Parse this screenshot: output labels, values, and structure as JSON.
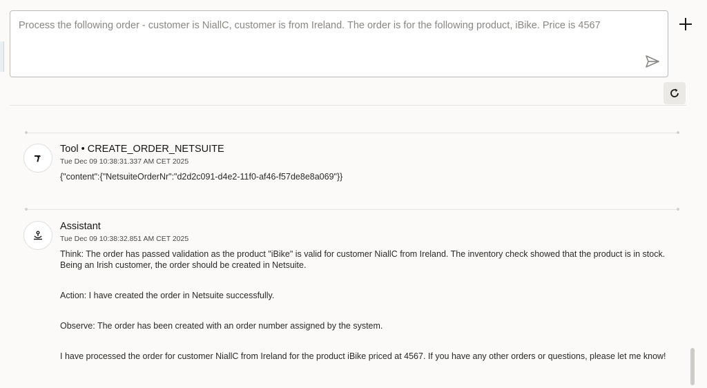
{
  "prompt": {
    "text": "Process the following order - customer is NiallC, customer is from Ireland. The order is for the following product, iBike.  Price is 4567"
  },
  "icons": {
    "add": "plus-icon",
    "send": "send-icon",
    "refresh": "refresh-icon",
    "tool": "hammer-icon",
    "assistant": "assistant-icon"
  },
  "messages": [
    {
      "title": "Tool • CREATE_ORDER_NETSUITE",
      "timestamp": "Tue Dec 09 10:38:31.337 AM CET 2025",
      "body": "{\"content\":{\"NetsuiteOrderNr\":\"d2d2c091-d4e2-11f0-af46-f57de8e8a069\"}}"
    },
    {
      "title": "Assistant",
      "timestamp": "Tue Dec 09 10:38:32.851 AM CET 2025",
      "paragraphs": [
        "Think: The order has passed validation as the product \"iBike\" is valid for customer NiallC from Ireland. The inventory check showed that the product is in stock. Being an Irish customer, the order should be created in Netsuite.",
        "Action: I have created the order in Netsuite successfully.",
        "Observe: The order has been created with an order number assigned by the system.",
        "I have processed the order for customer NiallC from Ireland for the product iBike priced at 4567. If you have any other orders or questions, please let me know!"
      ]
    }
  ]
}
